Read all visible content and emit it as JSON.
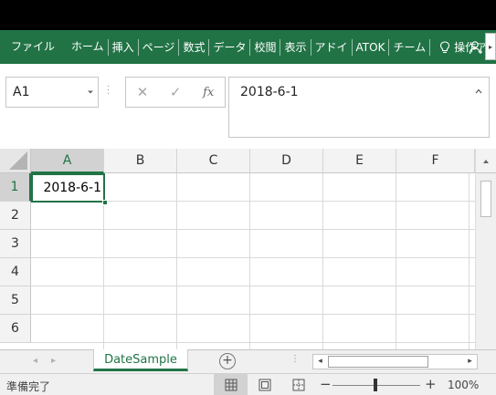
{
  "ribbon": {
    "tabs": [
      "ファイル",
      "ホーム",
      "挿入",
      "ページ",
      "数式",
      "データ",
      "校閲",
      "表示",
      "アドイ",
      "ATOK",
      "チーム"
    ],
    "tell_me": "操作アシス"
  },
  "formula_bar": {
    "name_box": "A1",
    "cancel_glyph": "✕",
    "enter_glyph": "✓",
    "fx_label": "fx",
    "content": "2018-6-1"
  },
  "grid": {
    "columns": [
      "A",
      "B",
      "C",
      "D",
      "E",
      "F"
    ],
    "rows": [
      "1",
      "2",
      "3",
      "4",
      "5",
      "6"
    ],
    "selected_column": "A",
    "selected_row": "1",
    "active_cell_value": "2018-6-1"
  },
  "sheets": {
    "tabs": [
      "DateSample"
    ],
    "active": "DateSample",
    "add_glyph": "+"
  },
  "status": {
    "text": "準備完了",
    "zoom": "100%"
  },
  "colors": {
    "accent": "#217346",
    "ribbon": "#217346"
  },
  "icons": [
    "lightbulb-icon",
    "user-icon",
    "chevron-down-icon",
    "select-all-icon",
    "normal-view-icon",
    "page-layout-icon",
    "page-break-icon"
  ]
}
